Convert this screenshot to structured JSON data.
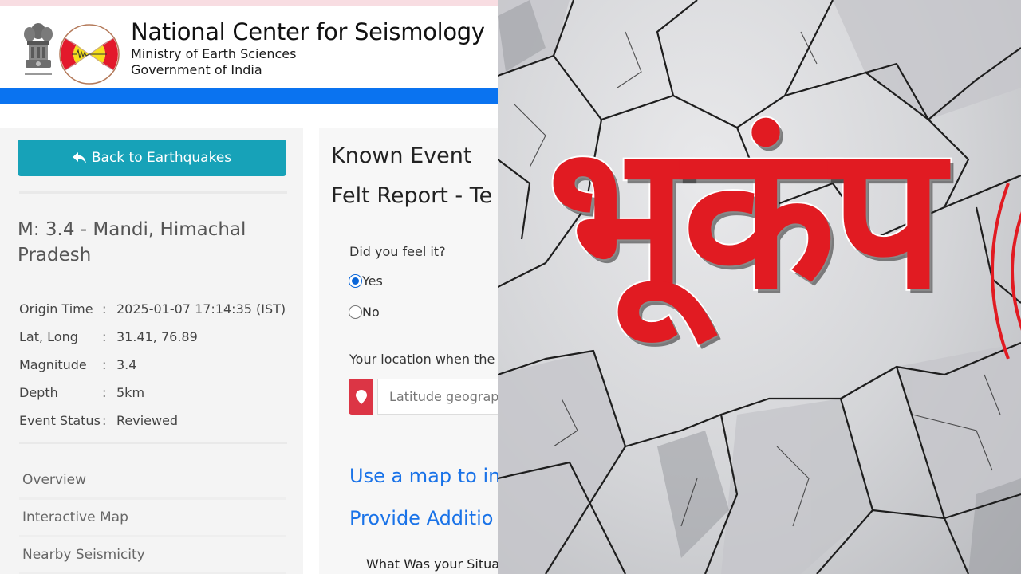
{
  "header": {
    "org_name": "National Center for Seismology",
    "ministry": "Ministry of Earth Sciences",
    "government": "Government of India",
    "emblem_icon": "state-emblem-icon",
    "logo_icon": "ncs-seismograph-logo-icon"
  },
  "colors": {
    "accent_blue": "#0a73f0",
    "button_teal": "#17a2b8",
    "link_blue": "#1a73e8",
    "danger_red": "#dc3545",
    "graphic_red": "#e11b22"
  },
  "sidebar": {
    "back_button": {
      "label": "Back to Earthquakes",
      "icon": "reply-arrow-icon"
    },
    "event_title": "M: 3.4 - Mandi, Himachal Pradesh",
    "details": [
      {
        "label": "Origin Time",
        "value": "2025-01-07 17:14:35 (IST)"
      },
      {
        "label": "Lat, Long",
        "value": "31.41, 76.89"
      },
      {
        "label": "Magnitude",
        "value": "3.4"
      },
      {
        "label": "Depth",
        "value": "5km"
      },
      {
        "label": "Event Status",
        "value": "Reviewed"
      }
    ],
    "nav": [
      {
        "label": "Overview"
      },
      {
        "label": "Interactive Map"
      },
      {
        "label": "Nearby Seismicity"
      }
    ]
  },
  "main": {
    "heading_line1": "Known Event",
    "heading_line2": "Felt Report - Te",
    "felt_question": "Did you feel it?",
    "felt_options": [
      {
        "label": "Yes",
        "checked": true
      },
      {
        "label": "No",
        "checked": false
      }
    ],
    "location_label": "Your location when the",
    "location_icon": "map-pin-icon",
    "location_placeholder": "Latitude geograp",
    "link_map": "Use a map to in",
    "link_additional": "Provide Additio",
    "situation_question": "What Was your Situa"
  },
  "graphic": {
    "hindi_word": "भूकंप",
    "meaning": "Earthquake"
  }
}
